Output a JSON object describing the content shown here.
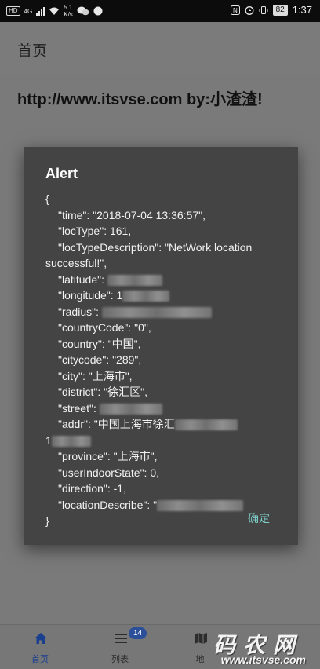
{
  "status_bar": {
    "hd": "HD",
    "network": "4G",
    "speed_value": "5.1",
    "speed_unit": "K/s",
    "battery": "82",
    "time": "1:37"
  },
  "app_bar": {
    "title": "首页"
  },
  "page": {
    "text": "http://www.itsvse.com by:小渣渣!"
  },
  "dialog": {
    "title": "Alert",
    "open_brace": "{",
    "close_brace": "}",
    "lines": {
      "time": "\"time\": \"2018-07-04 13:36:57\",",
      "locType": "\"locType\": 161,",
      "locTypeDescription_1": "\"locTypeDescription\": \"NetWork location",
      "locTypeDescription_2": "successful!\",",
      "latitude": "\"latitude\": ",
      "longitude": "\"longitude\": 1",
      "radius": "\"radius\": ",
      "countryCode": "\"countryCode\": \"0\",",
      "country": "\"country\": \"中国\",",
      "citycode": "\"citycode\": \"289\",",
      "city": "\"city\": \"上海市\",",
      "district": "\"district\": \"徐汇区\",",
      "street": "\"street\": ",
      "addr_1": "\"addr\": \"中国上海市徐汇",
      "addr_2": "1",
      "province": "\"province\": \"上海市\",",
      "userIndoorState": "\"userIndoorState\": 0,",
      "direction": "\"direction\": -1,",
      "locationDescribe": "\"locationDescribe\": \""
    },
    "ok_label": "确定"
  },
  "tabs": [
    {
      "label": "首页",
      "icon": "home-icon",
      "active": true
    },
    {
      "label": "列表",
      "icon": "list-icon",
      "badge": "14"
    },
    {
      "label": "地",
      "icon": "map-icon"
    }
  ],
  "watermark": {
    "cn": "码农网",
    "url": "www.itsvse.com"
  }
}
